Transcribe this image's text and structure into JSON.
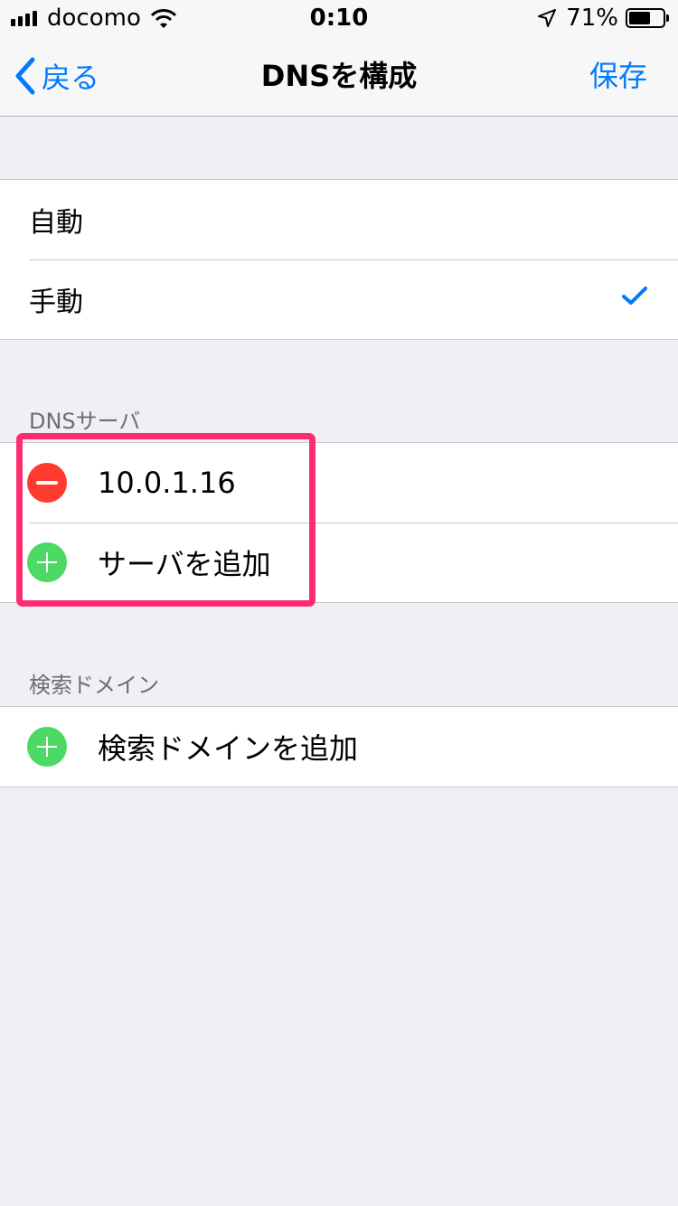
{
  "status_bar": {
    "carrier": "docomo",
    "time": "0:10",
    "battery_percent_text": "71%",
    "battery_level": 0.71,
    "signal_bars": 4
  },
  "nav": {
    "back_label": "戻る",
    "title": "DNSを構成",
    "save_label": "保存"
  },
  "dns_mode": {
    "options": [
      "自動",
      "手動"
    ],
    "selected": "手動"
  },
  "dns_servers": {
    "header": "DNSサーバ",
    "entries": [
      "10.0.1.16"
    ],
    "add_label": "サーバを追加"
  },
  "search_domains": {
    "header": "検索ドメイン",
    "add_label": "検索ドメインを追加"
  },
  "colors": {
    "accent": "#007aff",
    "delete": "#ff3b30",
    "add": "#4cd964",
    "highlight": "#ff2d6f",
    "background": "#efeff4"
  }
}
